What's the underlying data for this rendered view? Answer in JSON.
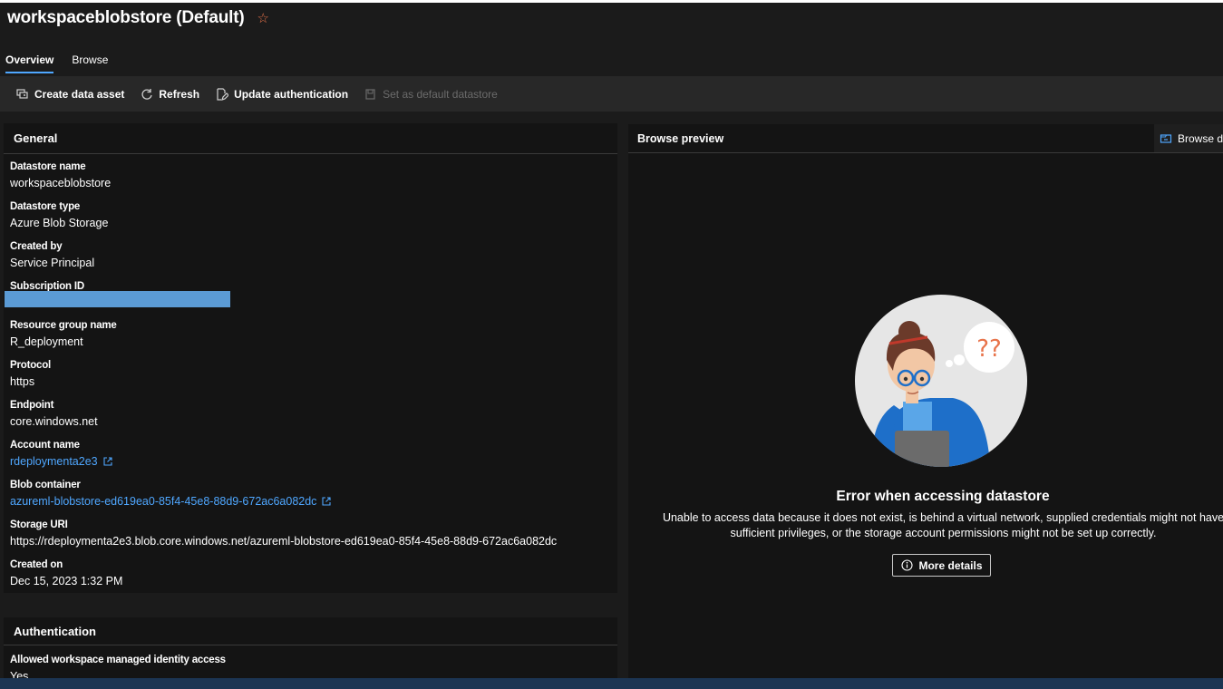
{
  "header": {
    "title": "workspaceblobstore (Default)",
    "favorite_icon": "star-icon"
  },
  "tabs": [
    {
      "label": "Overview",
      "active": true
    },
    {
      "label": "Browse",
      "active": false
    }
  ],
  "toolbar": {
    "create_data_asset": "Create data asset",
    "refresh": "Refresh",
    "update_authentication": "Update authentication",
    "set_default": "Set as default datastore"
  },
  "general": {
    "heading": "General",
    "datastore_name": {
      "label": "Datastore name",
      "value": "workspaceblobstore"
    },
    "datastore_type": {
      "label": "Datastore type",
      "value": "Azure Blob Storage"
    },
    "created_by": {
      "label": "Created by",
      "value": "Service Principal"
    },
    "subscription_id": {
      "label": "Subscription ID"
    },
    "resource_group": {
      "label": "Resource group name",
      "value": "R_deployment"
    },
    "protocol": {
      "label": "Protocol",
      "value": "https"
    },
    "endpoint": {
      "label": "Endpoint",
      "value": "core.windows.net"
    },
    "account_name": {
      "label": "Account name",
      "value": "rdeploymenta2e3"
    },
    "blob_container": {
      "label": "Blob container",
      "value": "azureml-blobstore-ed619ea0-85f4-45e8-88d9-672ac6a082dc"
    },
    "storage_uri": {
      "label": "Storage URI",
      "value": "https://rdeploymenta2e3.blob.core.windows.net/azureml-blobstore-ed619ea0-85f4-45e8-88d9-672ac6a082dc"
    },
    "created_on": {
      "label": "Created on",
      "value": "Dec 15, 2023 1:32 PM"
    }
  },
  "authentication": {
    "heading": "Authentication",
    "managed_identity": {
      "label": "Allowed workspace managed identity access",
      "value": "Yes"
    }
  },
  "preview": {
    "heading": "Browse preview",
    "browse_button": "Browse data",
    "thought_text": "??",
    "error_title": "Error when accessing datastore",
    "error_description": "Unable to access data because it does not exist, is behind a virtual network, supplied credentials might not have sufficient privileges, or the storage account permissions might not be set up correctly.",
    "more_details": "More details"
  },
  "colors": {
    "accent": "#4fa7ff",
    "star": "#e8734a",
    "redaction": "#5b9bd5",
    "background": "#1b1b1b",
    "card": "#141414"
  }
}
